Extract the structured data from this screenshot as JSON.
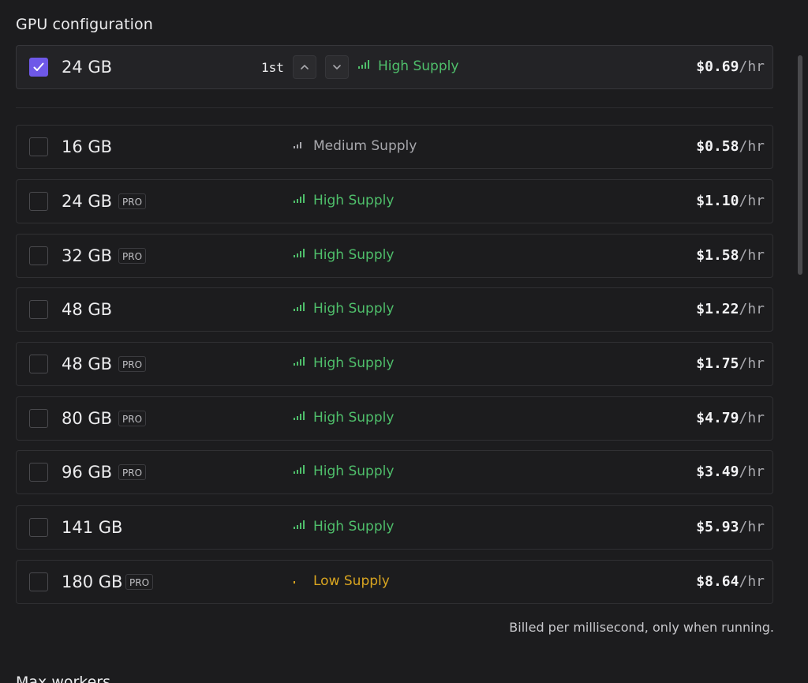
{
  "section": {
    "title": "GPU configuration",
    "next_heading": "Max workers",
    "billing_note": "Billed per millisecond, only when running."
  },
  "selected": {
    "size": "24 GB",
    "rank": "1st",
    "supply_label": "High Supply",
    "supply_level": "high",
    "price": "$0.69",
    "unit": "/hr",
    "checked": true
  },
  "options": [
    {
      "size": "16 GB",
      "pro": "",
      "supply_label": "Medium Supply",
      "supply_level": "medium",
      "price": "$0.58",
      "unit": "/hr"
    },
    {
      "size": "24 GB",
      "pro": "PRO",
      "supply_label": "High Supply",
      "supply_level": "high",
      "price": "$1.10",
      "unit": "/hr"
    },
    {
      "size": "32 GB",
      "pro": "PRO",
      "supply_label": "High Supply",
      "supply_level": "high",
      "price": "$1.58",
      "unit": "/hr"
    },
    {
      "size": "48 GB",
      "pro": "",
      "supply_label": "High Supply",
      "supply_level": "high",
      "price": "$1.22",
      "unit": "/hr"
    },
    {
      "size": "48 GB",
      "pro": "PRO",
      "supply_label": "High Supply",
      "supply_level": "high",
      "price": "$1.75",
      "unit": "/hr"
    },
    {
      "size": "80 GB",
      "pro": "PRO",
      "supply_label": "High Supply",
      "supply_level": "high",
      "price": "$4.79",
      "unit": "/hr"
    },
    {
      "size": "96 GB",
      "pro": "PRO",
      "supply_label": "High Supply",
      "supply_level": "high",
      "price": "$3.49",
      "unit": "/hr"
    },
    {
      "size": "141 GB",
      "pro": "",
      "supply_label": "High Supply",
      "supply_level": "high",
      "price": "$5.93",
      "unit": "/hr"
    },
    {
      "size": "180 GB",
      "pro": "PRO",
      "supply_label": "Low Supply",
      "supply_level": "low",
      "price": "$8.64",
      "unit": "/hr"
    }
  ],
  "colors": {
    "accent": "#6e58e8",
    "high_supply": "#4fbf6b",
    "medium_supply": "#a8a8ad",
    "low_supply": "#d9a520",
    "background": "#1c1c1e"
  },
  "icons": {
    "check": "check-icon",
    "up": "chevron-up-icon",
    "down": "chevron-down-icon",
    "signal": "signal-bars-icon"
  }
}
